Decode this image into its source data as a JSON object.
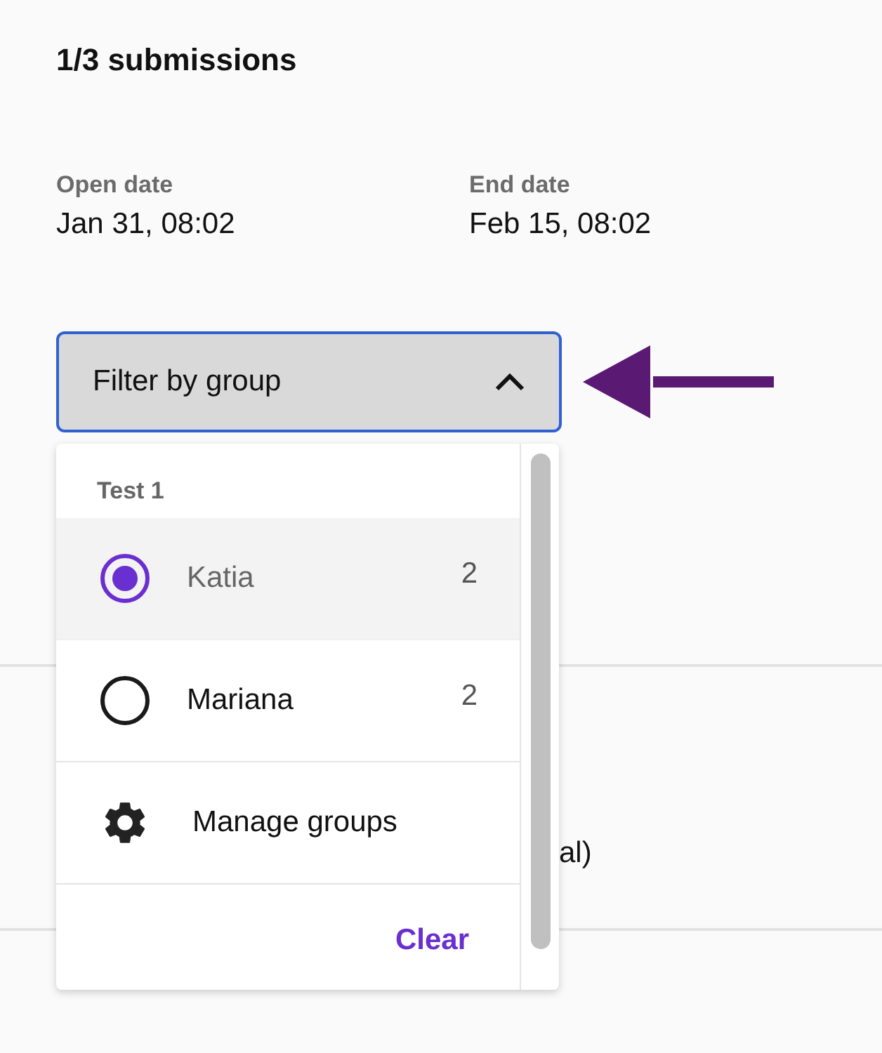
{
  "title": "1/3 submissions",
  "dates": [
    {
      "label": "Open date",
      "value": "Jan 31, 08:02"
    },
    {
      "label": "End date",
      "value": "Feb 15, 08:02"
    }
  ],
  "filter": {
    "label": "Filter by group",
    "expanded": true
  },
  "menu": {
    "group_title": "Test 1",
    "options": [
      {
        "name": "Katia",
        "count": "2",
        "selected": true
      },
      {
        "name": "Mariana",
        "count": "2",
        "selected": false
      }
    ],
    "manage": "Manage groups",
    "clear": "Clear"
  },
  "background_text": "al)"
}
